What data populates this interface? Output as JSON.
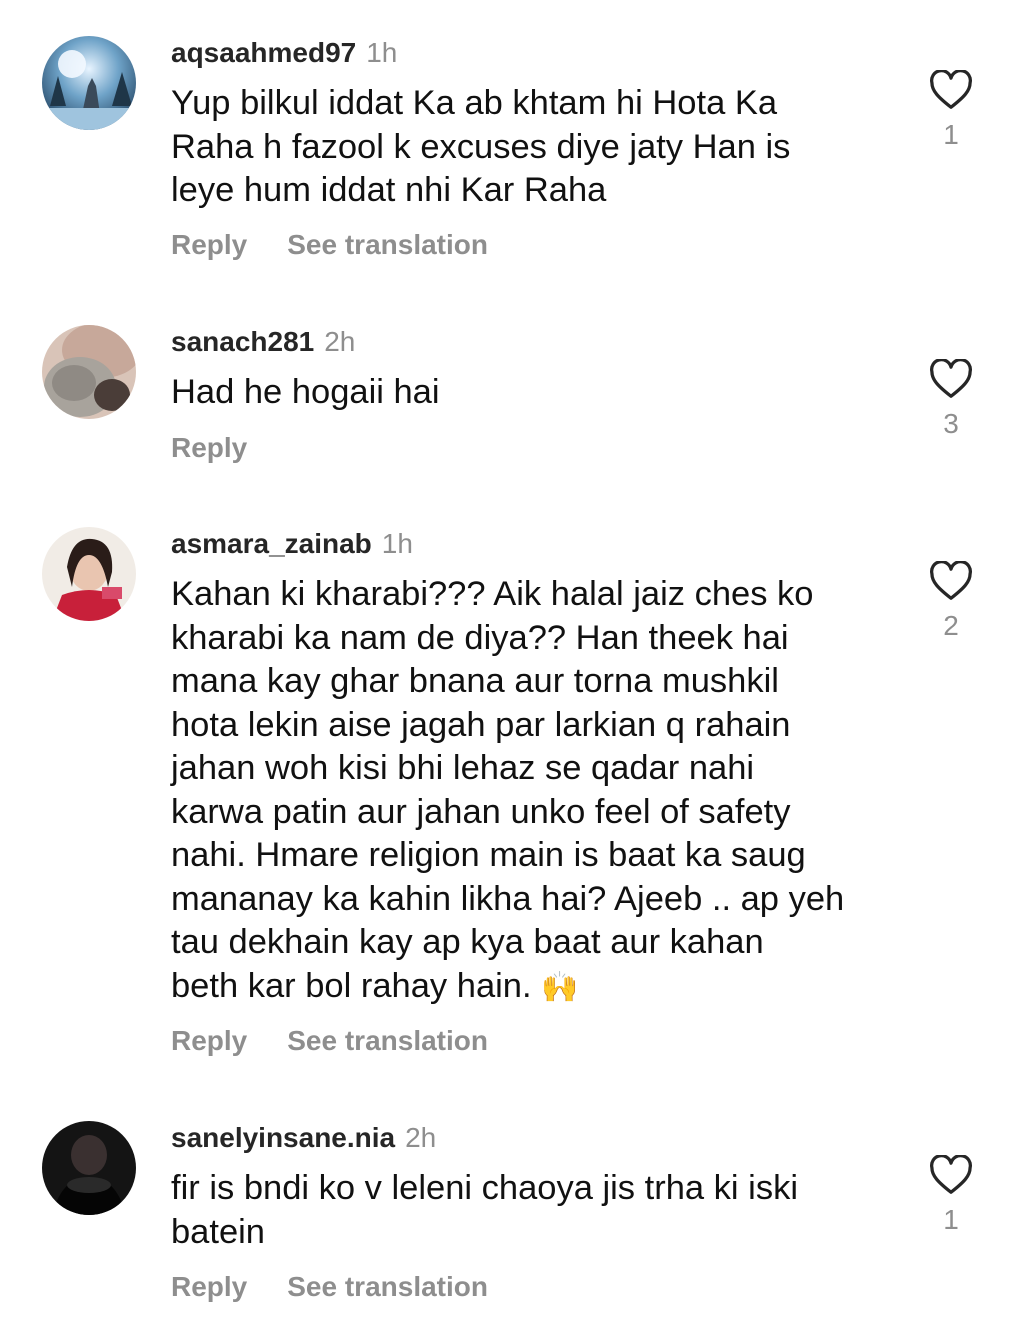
{
  "comments": [
    {
      "username": "aqsaahmed97",
      "time": "1h",
      "text": "Yup bilkul iddat Ka ab khtam hi Hota Ka\nRaha h fazool k excuses diye jaty Han is\nleye hum iddat nhi Kar Raha",
      "reply_label": "Reply",
      "translate_label": "See translation",
      "likes": "1"
    },
    {
      "username": "sanach281",
      "time": "2h",
      "text": "Had he hogaii hai",
      "reply_label": "Reply",
      "likes": "3"
    },
    {
      "username": "asmara_zainab",
      "time": "1h",
      "text": "Kahan ki kharabi??? Aik halal jaiz ches ko\nkharabi ka nam de diya?? Han theek hai\nmana kay ghar bnana aur torna mushkil\nhota lekin aise jagah par larkian q rahain\njahan woh kisi bhi lehaz se qadar nahi\nkarwa patin aur jahan unko feel of safety\nnahi. Hmare religion main is baat ka saug\nmananay ka kahin likha hai? Ajeeb .. ap yeh\ntau dekhain kay ap kya baat aur kahan\nbeth kar bol rahay hain.",
      "emoji": "🙌",
      "reply_label": "Reply",
      "translate_label": "See translation",
      "likes": "2"
    },
    {
      "username": "sanelyinsane.nia",
      "time": "2h",
      "text": "fir is bndi ko v leleni chaoya jis trha ki iski\nbatein",
      "reply_label": "Reply",
      "translate_label": "See translation",
      "likes": "1"
    }
  ],
  "icons": {
    "like": "heart-outline-icon"
  },
  "colors": {
    "text": "#111111",
    "muted": "#8e8e8e",
    "username": "#262626"
  }
}
